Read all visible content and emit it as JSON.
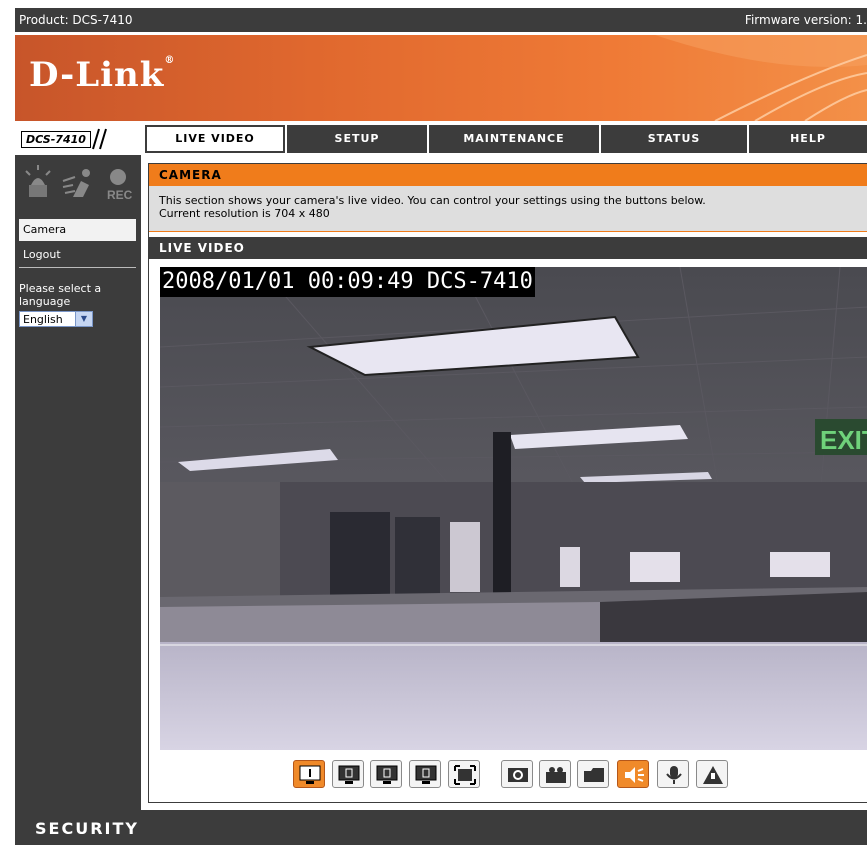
{
  "topbar": {
    "product": "Product: DCS-7410",
    "firmware": "Firmware version: 1."
  },
  "banner": {
    "logo": "D-Link",
    "trademark": "®"
  },
  "model": "DCS-7410",
  "nav": [
    {
      "label": "LIVE VIDEO",
      "active": true
    },
    {
      "label": "SETUP",
      "active": false
    },
    {
      "label": "MAINTENANCE",
      "active": false
    },
    {
      "label": "STATUS",
      "active": false
    },
    {
      "label": "HELP",
      "active": false
    }
  ],
  "sidebar": {
    "status_icons": {
      "rec_label": "REC"
    },
    "items": [
      {
        "label": "Camera",
        "active": true
      },
      {
        "label": "Logout",
        "active": false
      }
    ],
    "language_label": "Please select a language",
    "language_value": "English"
  },
  "camera_section": {
    "title": "CAMERA",
    "description_line1": "This section shows your camera's live video. You can control your settings using the buttons below.",
    "description_line2": "Current resolution is 704 x 480"
  },
  "live_video": {
    "title": "LIVE VIDEO",
    "timestamp": "2008/01/01 00:09:49 DCS-7410",
    "exit_sign": "EXIT"
  },
  "controls": [
    {
      "name": "single-view-1",
      "icon": "monitor-1-icon",
      "active": true
    },
    {
      "name": "view-2",
      "icon": "monitor-2-icon",
      "active": false
    },
    {
      "name": "view-3",
      "icon": "monitor-3-icon",
      "active": false
    },
    {
      "name": "view-4",
      "icon": "monitor-4-icon",
      "active": false
    },
    {
      "name": "fullscreen",
      "icon": "fullscreen-icon",
      "active": false
    },
    {
      "name": "snapshot",
      "icon": "camera-icon",
      "active": false
    },
    {
      "name": "record",
      "icon": "video-camera-icon",
      "active": false
    },
    {
      "name": "folder",
      "icon": "folder-icon",
      "active": false
    },
    {
      "name": "speaker",
      "icon": "speaker-icon",
      "active": true
    },
    {
      "name": "microphone",
      "icon": "microphone-icon",
      "active": false
    },
    {
      "name": "trigger",
      "icon": "alarm-icon",
      "active": false
    }
  ],
  "footer": {
    "label": "SECURITY"
  },
  "colors": {
    "dark": "#3c3c3c",
    "accent": "#f07c1b"
  }
}
